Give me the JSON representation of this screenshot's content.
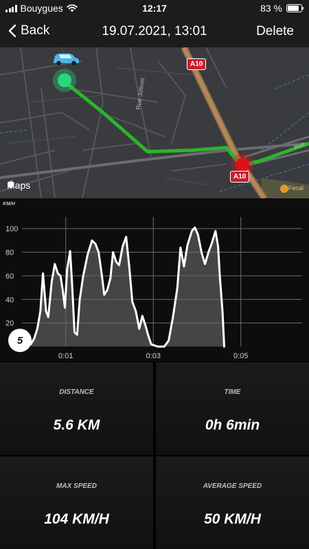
{
  "status_bar": {
    "carrier": "Bouygues",
    "time": "12:17",
    "battery": "83 %",
    "battery_level": 0.83,
    "wifi_icon": "wifi-icon",
    "signal_icon": "signal-bars-icon"
  },
  "nav": {
    "back_label": "Back",
    "title": "19.07.2021, 13:01",
    "delete_label": "Delete",
    "back_icon": "chevron-left-icon"
  },
  "map": {
    "attribution": "Maps",
    "road_sign_top": "A10",
    "road_sign_bottom": "A10",
    "street_label": "Rue Jollivet",
    "street_label_right": "Rue",
    "poi_label": "Fecal",
    "start_marker": "car-icon",
    "route_color": "#2bb52b",
    "start_color": "#2ad67a",
    "end_color": "#e0101a"
  },
  "speed_badge": "5",
  "chart_data": {
    "type": "area",
    "ylabel": "KM/H",
    "ylim": [
      0,
      110
    ],
    "yticks": [
      20,
      40,
      60,
      80,
      100
    ],
    "xlim": [
      0,
      6.4
    ],
    "xticks": [
      "0:01",
      "0:03",
      "0:05"
    ],
    "x_unit": "minutes",
    "grid": true,
    "series": [
      {
        "values": [
          [
            0.0,
            5
          ],
          [
            0.1,
            4
          ],
          [
            0.2,
            2
          ],
          [
            0.28,
            7
          ],
          [
            0.35,
            15
          ],
          [
            0.42,
            30
          ],
          [
            0.48,
            62
          ],
          [
            0.55,
            30
          ],
          [
            0.6,
            25
          ],
          [
            0.68,
            55
          ],
          [
            0.75,
            70
          ],
          [
            0.82,
            62
          ],
          [
            0.88,
            60
          ],
          [
            0.93,
            48
          ],
          [
            0.98,
            33
          ],
          [
            1.03,
            65
          ],
          [
            1.1,
            81
          ],
          [
            1.15,
            50
          ],
          [
            1.2,
            12
          ],
          [
            1.26,
            10
          ],
          [
            1.32,
            40
          ],
          [
            1.4,
            60
          ],
          [
            1.5,
            78
          ],
          [
            1.6,
            90
          ],
          [
            1.68,
            87
          ],
          [
            1.75,
            80
          ],
          [
            1.82,
            62
          ],
          [
            1.88,
            44
          ],
          [
            1.95,
            48
          ],
          [
            2.02,
            58
          ],
          [
            2.08,
            80
          ],
          [
            2.15,
            72
          ],
          [
            2.22,
            69
          ],
          [
            2.3,
            85
          ],
          [
            2.38,
            93
          ],
          [
            2.45,
            68
          ],
          [
            2.52,
            38
          ],
          [
            2.6,
            30
          ],
          [
            2.68,
            15
          ],
          [
            2.75,
            26
          ],
          [
            2.82,
            18
          ],
          [
            2.88,
            10
          ],
          [
            2.95,
            2
          ],
          [
            3.1,
            0
          ],
          [
            3.25,
            0
          ],
          [
            3.35,
            5
          ],
          [
            3.45,
            25
          ],
          [
            3.55,
            50
          ],
          [
            3.62,
            84
          ],
          [
            3.7,
            68
          ],
          [
            3.78,
            86
          ],
          [
            3.88,
            98
          ],
          [
            3.95,
            101
          ],
          [
            4.02,
            95
          ],
          [
            4.1,
            80
          ],
          [
            4.18,
            70
          ],
          [
            4.26,
            80
          ],
          [
            4.34,
            88
          ],
          [
            4.42,
            98
          ],
          [
            4.48,
            85
          ],
          [
            4.52,
            60
          ],
          [
            4.58,
            30
          ],
          [
            4.62,
            0
          ]
        ]
      }
    ]
  },
  "stats": {
    "distance_label": "DISTANCE",
    "distance_value": "5.6 KM",
    "time_label": "TIME",
    "time_value": "0h 6min",
    "max_speed_label": "MAX SPEED",
    "max_speed_value": "104 KM/H",
    "avg_speed_label": "AVERAGE SPEED",
    "avg_speed_value": "50 KM/H"
  }
}
